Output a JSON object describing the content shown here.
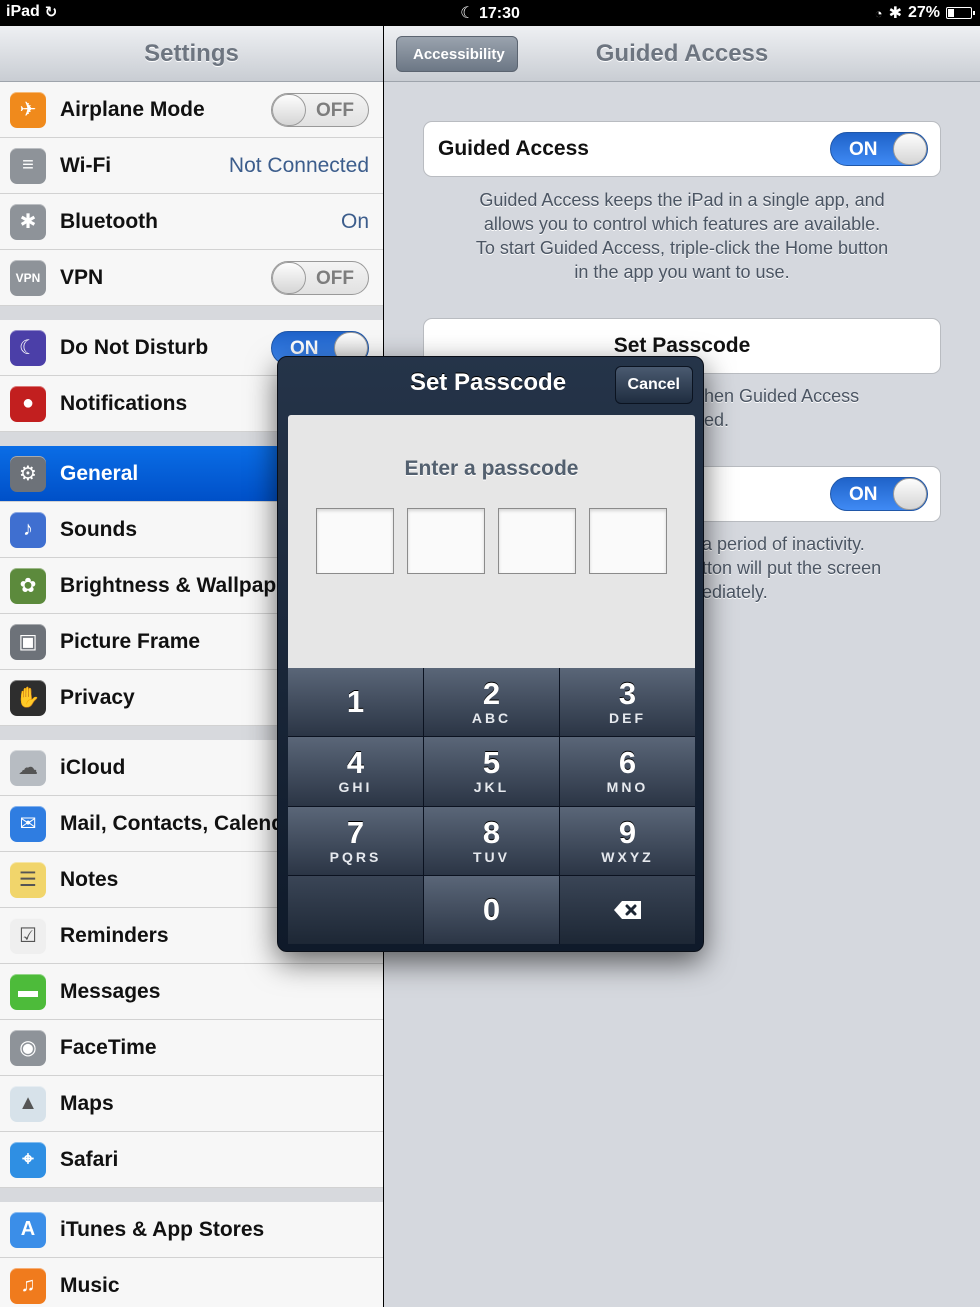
{
  "status": {
    "device": "iPad",
    "time": "17:30",
    "battery": "27%"
  },
  "settings": {
    "title": "Settings",
    "groups": [
      [
        {
          "label": "Airplane Mode",
          "icon": "airplane-icon",
          "color": "#f08a1c",
          "toggle": "OFF"
        },
        {
          "label": "Wi-Fi",
          "icon": "wifi-icon",
          "color": "#8e9399",
          "value": "Not Connected"
        },
        {
          "label": "Bluetooth",
          "icon": "bluetooth-icon",
          "color": "#8e9399",
          "value": "On"
        },
        {
          "label": "VPN",
          "icon": "vpn-icon",
          "color": "#8e9399",
          "toggle": "OFF"
        }
      ],
      [
        {
          "label": "Do Not Disturb",
          "icon": "moon-icon",
          "color": "#4b3fa8",
          "toggle": "ON"
        },
        {
          "label": "Notifications",
          "icon": "notifications-icon",
          "color": "#c21f1f"
        }
      ],
      [
        {
          "label": "General",
          "icon": "gear-icon",
          "color": "#6d7279",
          "selected": true
        },
        {
          "label": "Sounds",
          "icon": "speaker-icon",
          "color": "#3f6fd0"
        },
        {
          "label": "Brightness & Wallpaper",
          "icon": "flower-icon",
          "color": "#5c8a3c"
        },
        {
          "label": "Picture Frame",
          "icon": "picture-frame-icon",
          "color": "#6d7279"
        },
        {
          "label": "Privacy",
          "icon": "hand-icon",
          "color": "#2e2e2e"
        }
      ],
      [
        {
          "label": "iCloud",
          "icon": "cloud-icon",
          "color": "#b7bcc2"
        },
        {
          "label": "Mail, Contacts, Calendars",
          "icon": "mail-icon",
          "color": "#2f7de1"
        },
        {
          "label": "Notes",
          "icon": "notes-icon",
          "color": "#f1d56b"
        },
        {
          "label": "Reminders",
          "icon": "reminders-icon",
          "color": "#efefef"
        },
        {
          "label": "Messages",
          "icon": "messages-icon",
          "color": "#4dbb3a"
        },
        {
          "label": "FaceTime",
          "icon": "facetime-icon",
          "color": "#8e9399"
        },
        {
          "label": "Maps",
          "icon": "maps-icon",
          "color": "#d7e2ea"
        },
        {
          "label": "Safari",
          "icon": "safari-icon",
          "color": "#2f8fe3"
        }
      ],
      [
        {
          "label": "iTunes & App Stores",
          "icon": "app-store-icon",
          "color": "#3b8ee8"
        },
        {
          "label": "Music",
          "icon": "music-icon",
          "color": "#f07b1d"
        }
      ]
    ]
  },
  "detail": {
    "back_label": "Accessibility",
    "title": "Guided Access",
    "guided_access_label": "Guided Access",
    "guided_access_toggle": "ON",
    "description_lines": [
      "Guided Access keeps the iPad in a single app, and",
      "allows you to control which features are available.",
      "To start Guided Access, triple-click the Home button",
      "in the app you want to use."
    ],
    "set_passcode_label": "Set Passcode",
    "passcode_footer_lines": [
      "hen Guided Access",
      "ed."
    ],
    "second_toggle": "ON",
    "second_footer_lines": [
      "a period of inactivity.",
      "tton will put the screen",
      "ediately."
    ]
  },
  "popup": {
    "title": "Set Passcode",
    "cancel_label": "Cancel",
    "prompt": "Enter a passcode",
    "keys": [
      {
        "num": "1",
        "sub": ""
      },
      {
        "num": "2",
        "sub": "ABC"
      },
      {
        "num": "3",
        "sub": "DEF"
      },
      {
        "num": "4",
        "sub": "GHI"
      },
      {
        "num": "5",
        "sub": "JKL"
      },
      {
        "num": "6",
        "sub": "MNO"
      },
      {
        "num": "7",
        "sub": "PQRS"
      },
      {
        "num": "8",
        "sub": "TUV"
      },
      {
        "num": "9",
        "sub": "WXYZ"
      }
    ],
    "zero": "0"
  }
}
